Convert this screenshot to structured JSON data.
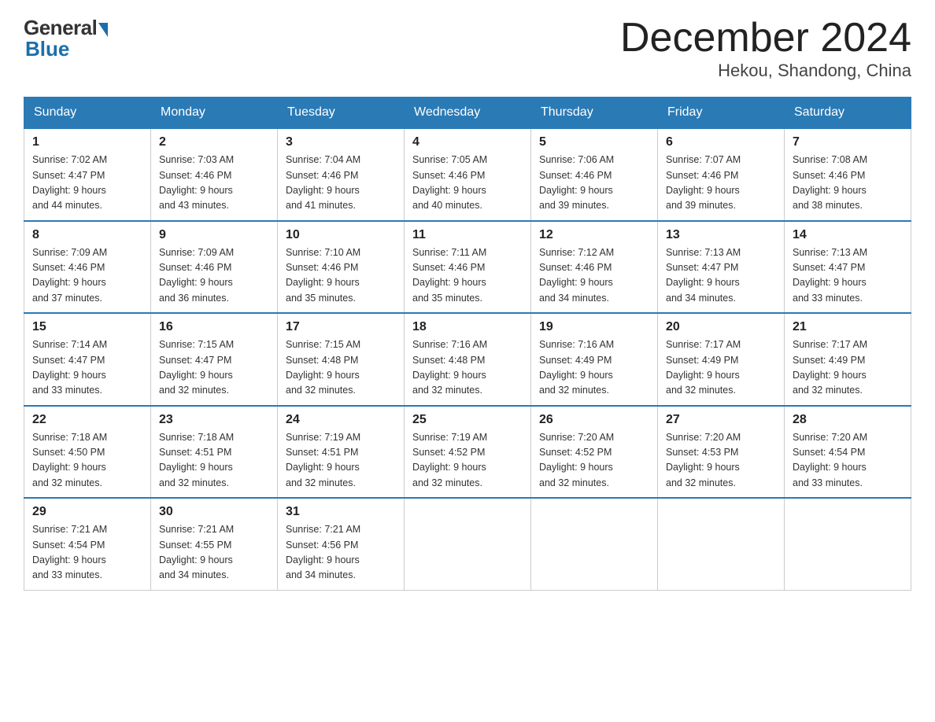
{
  "header": {
    "logo": {
      "general": "General",
      "blue": "Blue"
    },
    "title": "December 2024",
    "location": "Hekou, Shandong, China"
  },
  "days_of_week": [
    "Sunday",
    "Monday",
    "Tuesday",
    "Wednesday",
    "Thursday",
    "Friday",
    "Saturday"
  ],
  "weeks": [
    [
      {
        "day": "1",
        "sunrise": "7:02 AM",
        "sunset": "4:47 PM",
        "daylight": "9 hours and 44 minutes."
      },
      {
        "day": "2",
        "sunrise": "7:03 AM",
        "sunset": "4:46 PM",
        "daylight": "9 hours and 43 minutes."
      },
      {
        "day": "3",
        "sunrise": "7:04 AM",
        "sunset": "4:46 PM",
        "daylight": "9 hours and 41 minutes."
      },
      {
        "day": "4",
        "sunrise": "7:05 AM",
        "sunset": "4:46 PM",
        "daylight": "9 hours and 40 minutes."
      },
      {
        "day": "5",
        "sunrise": "7:06 AM",
        "sunset": "4:46 PM",
        "daylight": "9 hours and 39 minutes."
      },
      {
        "day": "6",
        "sunrise": "7:07 AM",
        "sunset": "4:46 PM",
        "daylight": "9 hours and 39 minutes."
      },
      {
        "day": "7",
        "sunrise": "7:08 AM",
        "sunset": "4:46 PM",
        "daylight": "9 hours and 38 minutes."
      }
    ],
    [
      {
        "day": "8",
        "sunrise": "7:09 AM",
        "sunset": "4:46 PM",
        "daylight": "9 hours and 37 minutes."
      },
      {
        "day": "9",
        "sunrise": "7:09 AM",
        "sunset": "4:46 PM",
        "daylight": "9 hours and 36 minutes."
      },
      {
        "day": "10",
        "sunrise": "7:10 AM",
        "sunset": "4:46 PM",
        "daylight": "9 hours and 35 minutes."
      },
      {
        "day": "11",
        "sunrise": "7:11 AM",
        "sunset": "4:46 PM",
        "daylight": "9 hours and 35 minutes."
      },
      {
        "day": "12",
        "sunrise": "7:12 AM",
        "sunset": "4:46 PM",
        "daylight": "9 hours and 34 minutes."
      },
      {
        "day": "13",
        "sunrise": "7:13 AM",
        "sunset": "4:47 PM",
        "daylight": "9 hours and 34 minutes."
      },
      {
        "day": "14",
        "sunrise": "7:13 AM",
        "sunset": "4:47 PM",
        "daylight": "9 hours and 33 minutes."
      }
    ],
    [
      {
        "day": "15",
        "sunrise": "7:14 AM",
        "sunset": "4:47 PM",
        "daylight": "9 hours and 33 minutes."
      },
      {
        "day": "16",
        "sunrise": "7:15 AM",
        "sunset": "4:47 PM",
        "daylight": "9 hours and 32 minutes."
      },
      {
        "day": "17",
        "sunrise": "7:15 AM",
        "sunset": "4:48 PM",
        "daylight": "9 hours and 32 minutes."
      },
      {
        "day": "18",
        "sunrise": "7:16 AM",
        "sunset": "4:48 PM",
        "daylight": "9 hours and 32 minutes."
      },
      {
        "day": "19",
        "sunrise": "7:16 AM",
        "sunset": "4:49 PM",
        "daylight": "9 hours and 32 minutes."
      },
      {
        "day": "20",
        "sunrise": "7:17 AM",
        "sunset": "4:49 PM",
        "daylight": "9 hours and 32 minutes."
      },
      {
        "day": "21",
        "sunrise": "7:17 AM",
        "sunset": "4:49 PM",
        "daylight": "9 hours and 32 minutes."
      }
    ],
    [
      {
        "day": "22",
        "sunrise": "7:18 AM",
        "sunset": "4:50 PM",
        "daylight": "9 hours and 32 minutes."
      },
      {
        "day": "23",
        "sunrise": "7:18 AM",
        "sunset": "4:51 PM",
        "daylight": "9 hours and 32 minutes."
      },
      {
        "day": "24",
        "sunrise": "7:19 AM",
        "sunset": "4:51 PM",
        "daylight": "9 hours and 32 minutes."
      },
      {
        "day": "25",
        "sunrise": "7:19 AM",
        "sunset": "4:52 PM",
        "daylight": "9 hours and 32 minutes."
      },
      {
        "day": "26",
        "sunrise": "7:20 AM",
        "sunset": "4:52 PM",
        "daylight": "9 hours and 32 minutes."
      },
      {
        "day": "27",
        "sunrise": "7:20 AM",
        "sunset": "4:53 PM",
        "daylight": "9 hours and 32 minutes."
      },
      {
        "day": "28",
        "sunrise": "7:20 AM",
        "sunset": "4:54 PM",
        "daylight": "9 hours and 33 minutes."
      }
    ],
    [
      {
        "day": "29",
        "sunrise": "7:21 AM",
        "sunset": "4:54 PM",
        "daylight": "9 hours and 33 minutes."
      },
      {
        "day": "30",
        "sunrise": "7:21 AM",
        "sunset": "4:55 PM",
        "daylight": "9 hours and 34 minutes."
      },
      {
        "day": "31",
        "sunrise": "7:21 AM",
        "sunset": "4:56 PM",
        "daylight": "9 hours and 34 minutes."
      },
      null,
      null,
      null,
      null
    ]
  ],
  "labels": {
    "sunrise": "Sunrise: ",
    "sunset": "Sunset: ",
    "daylight": "Daylight: "
  }
}
